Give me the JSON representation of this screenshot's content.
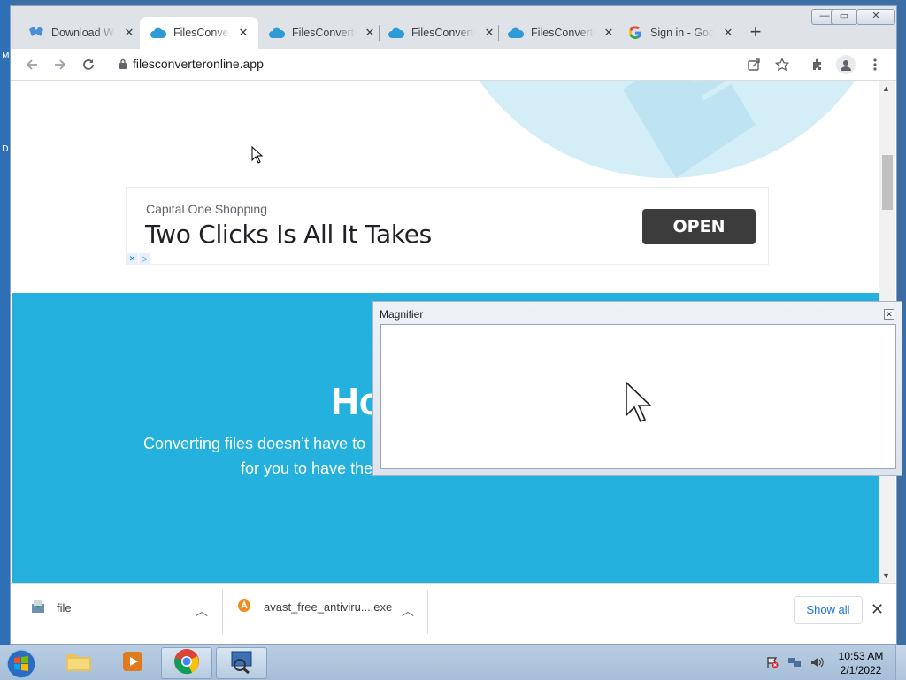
{
  "desktop": {
    "left_labels": [
      "M",
      "D"
    ]
  },
  "browser": {
    "tabs": [
      {
        "label": "Download W",
        "icon": "sheep-icon",
        "active": false
      },
      {
        "label": "FilesConverte",
        "icon": "cloud-icon",
        "active": true
      },
      {
        "label": "FilesConverte",
        "icon": "cloud-icon",
        "active": false
      },
      {
        "label": "FilesConverte",
        "icon": "cloud-icon",
        "active": false
      },
      {
        "label": "FilesConverte",
        "icon": "cloud-icon",
        "active": false
      },
      {
        "label": "Sign in - Goo",
        "icon": "google-icon",
        "active": false
      }
    ],
    "new_tab": "+",
    "url": "filesconverteronline.app",
    "window_controls": {
      "minimize": "—",
      "maximize": "▭",
      "close": "✕"
    }
  },
  "page": {
    "ad": {
      "brand": "Capital One Shopping",
      "headline": "Two Clicks Is All It Takes",
      "cta": "OPEN",
      "choices": [
        "✕",
        "▷"
      ]
    },
    "hero": {
      "title_visible": "Ho",
      "line1_visible": "Converting files doesn’t have to",
      "line2_visible": "for you to have the"
    }
  },
  "downloads": {
    "items": [
      {
        "name": "file",
        "icon": "installer-icon"
      },
      {
        "name": "avast_free_antiviru....exe",
        "icon": "avast-icon"
      }
    ],
    "show_all": "Show all",
    "close": "✕"
  },
  "magnifier": {
    "title": "Magnifier",
    "close": "✕"
  },
  "taskbar": {
    "time": "10:53 AM",
    "date": "2/1/2022"
  },
  "colors": {
    "hero_blue": "#24b1de",
    "ad_button": "#3c3c3c",
    "link_blue": "#1a73e8",
    "taskbar": "#a6bed8"
  }
}
